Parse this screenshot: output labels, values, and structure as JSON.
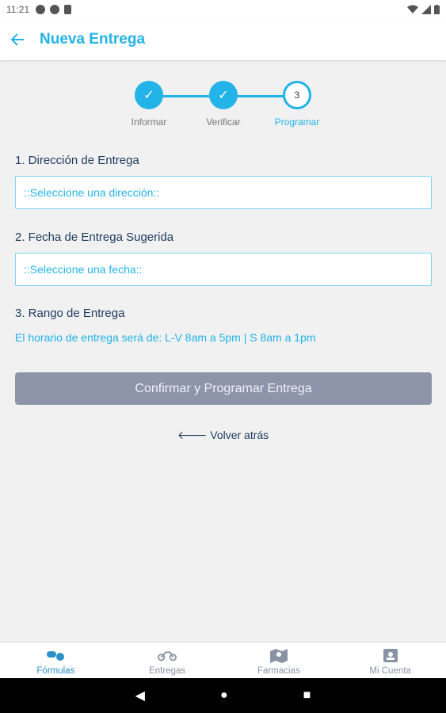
{
  "status_bar": {
    "time": "11:21"
  },
  "app_bar": {
    "title": "Nueva Entrega"
  },
  "stepper": {
    "steps": [
      {
        "label": "Informar",
        "mark": "✓"
      },
      {
        "label": "Verificar",
        "mark": "✓"
      },
      {
        "label": "Programar",
        "mark": "3"
      }
    ]
  },
  "form": {
    "address_label": "1. Dirección de Entrega",
    "address_placeholder": "::Seleccione una dirección::",
    "date_label": "2. Fecha de Entrega Sugerida",
    "date_placeholder": "::Seleccione una fecha::",
    "range_label": "3. Rango de Entrega",
    "range_info": "El horario de entrega será de: L-V 8am a 5pm | S 8am a 1pm"
  },
  "actions": {
    "confirm_label": "Confirmar y Programar Entrega",
    "back_label": "Volver atrás"
  },
  "bottom_nav": {
    "items": [
      {
        "label": "Fórmulas",
        "icon": "pills-icon"
      },
      {
        "label": "Entregas",
        "icon": "motorcycle-icon"
      },
      {
        "label": "Farmacias",
        "icon": "map-icon"
      },
      {
        "label": "Mi Cuenta",
        "icon": "id-badge-icon"
      }
    ]
  },
  "colors": {
    "accent": "#22b3e8",
    "text_dark": "#1e3a5f",
    "button_disabled": "#8e95ab"
  }
}
